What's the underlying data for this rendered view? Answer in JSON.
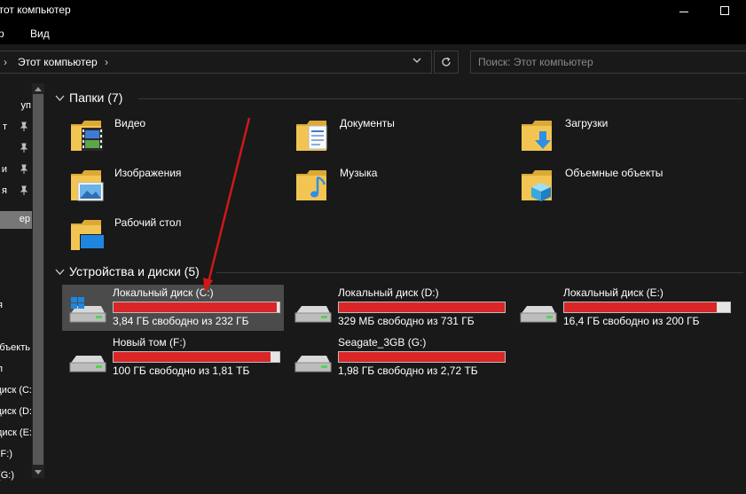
{
  "window": {
    "title": "Этот компьютер"
  },
  "menu": {
    "items": [
      "р",
      "Вид"
    ]
  },
  "address": {
    "path": "Этот компьютер",
    "search_placeholder": "Поиск: Этот компьютер"
  },
  "sidebar": {
    "items": [
      "уп",
      "т",
      "и",
      "я",
      "ер",
      "я",
      "объекть",
      "л",
      "диск (С:",
      "диск (D:",
      "диск (E:",
      "F:)",
      "(G:)"
    ]
  },
  "groups": {
    "folders": {
      "title": "Папки (7)",
      "items": [
        {
          "label": "Видео",
          "icon": "video-folder-icon"
        },
        {
          "label": "Документы",
          "icon": "documents-folder-icon"
        },
        {
          "label": "Загрузки",
          "icon": "downloads-folder-icon"
        },
        {
          "label": "Изображения",
          "icon": "pictures-folder-icon"
        },
        {
          "label": "Музыка",
          "icon": "music-folder-icon"
        },
        {
          "label": "Объемные объекты",
          "icon": "3d-objects-folder-icon"
        },
        {
          "label": "Рабочий стол",
          "icon": "desktop-folder-icon"
        }
      ]
    },
    "drives": {
      "title": "Устройства и диски (5)",
      "items": [
        {
          "name": "Локальный диск (C:)",
          "free": "3,84 ГБ свободно из 232 ГБ",
          "used_fraction": 0.983,
          "system": true
        },
        {
          "name": "Локальный диск (D:)",
          "free": "329 МБ свободно из 731 ГБ",
          "used_fraction": 0.9996,
          "system": false
        },
        {
          "name": "Локальный диск (E:)",
          "free": "16,4 ГБ свободно из 200 ГБ",
          "used_fraction": 0.918,
          "system": false
        },
        {
          "name": "Новый том (F:)",
          "free": "100 ГБ свободно из 1,81 ТБ",
          "used_fraction": 0.946,
          "system": false
        },
        {
          "name": "Seagate_3GB (G:)",
          "free": "1,98 ГБ свободно из 2,72 ТБ",
          "used_fraction": 0.9993,
          "system": false
        }
      ]
    }
  },
  "colors": {
    "usage_bar": "#da2626",
    "annotation_arrow": "#d01818",
    "folder": "#f2c553"
  }
}
